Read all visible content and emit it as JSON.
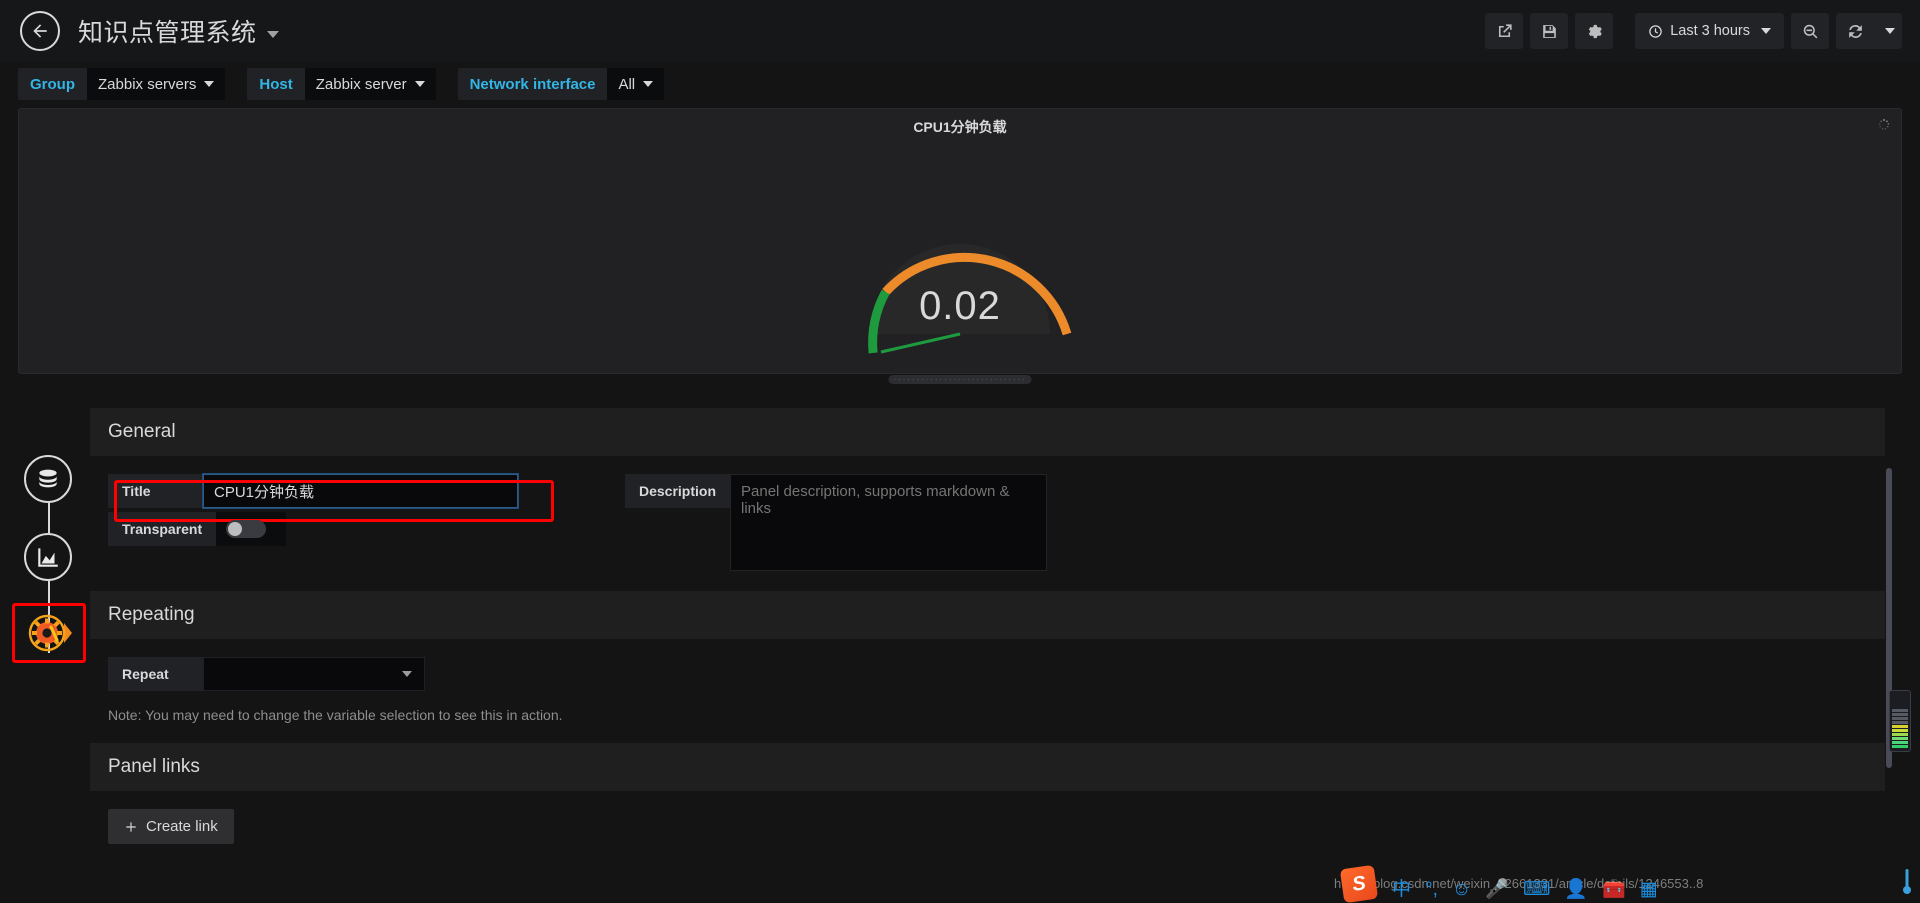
{
  "topnav": {
    "back_icon": "back-arrow-icon",
    "dashboard_title": "知识点管理系统",
    "share_icon": "share-icon",
    "save_icon": "save-icon",
    "settings_icon": "gear-icon",
    "time_range": "Last 3 hours",
    "time_clock_icon": "clock-icon",
    "zoom_out_icon": "zoom-out-icon",
    "refresh_icon": "refresh-icon",
    "refresh_caret_icon": "chevron-down-icon"
  },
  "variables": [
    {
      "label": "Group",
      "value": "Zabbix servers"
    },
    {
      "label": "Host",
      "value": "Zabbix server"
    },
    {
      "label": "Network interface",
      "value": "All"
    }
  ],
  "panel": {
    "title": "CPU1分钟负载",
    "spinner_icon": "loading-spinner-icon",
    "resize_handle": "resize-handle"
  },
  "chart_data": {
    "type": "gauge",
    "title": "CPU1分钟负载",
    "value": 0.02,
    "value_label": "0.02",
    "min": 0,
    "max": 100,
    "unit": "",
    "thresholds": [
      {
        "from": 0,
        "to": 10,
        "color": "#299c46"
      },
      {
        "from": 10,
        "to": 100,
        "color": "#ed8b2b"
      }
    ],
    "arc_start_angle": -130,
    "arc_end_angle": 130,
    "needle_color": "#299c46",
    "needle_angle": -130,
    "show_threshold_markers": true,
    "show_threshold_labels": false
  },
  "edit_rail": {
    "items": [
      {
        "name": "queries",
        "icon": "database-icon"
      },
      {
        "name": "visualization",
        "icon": "area-chart-icon"
      },
      {
        "name": "general",
        "icon": "gear-wrench-icon"
      }
    ]
  },
  "options": {
    "general": {
      "header": "General",
      "title_label": "Title",
      "title_value": "CPU1分钟负载",
      "transparent_label": "Transparent",
      "transparent_on": false,
      "description_label": "Description",
      "description_value": "",
      "description_placeholder": "Panel description, supports markdown & links"
    },
    "repeating": {
      "header": "Repeating",
      "repeat_label": "Repeat",
      "repeat_value": "",
      "repeat_placeholder": "",
      "note": "Note: You may need to change the variable selection to see this in action."
    },
    "panel_links": {
      "header": "Panel links",
      "create_link_label": "Create link",
      "create_link_icon": "plus-icon"
    }
  },
  "highlights": {
    "title_field_color": "#ff0000",
    "rail_general_color": "#ff0000"
  },
  "ime": {
    "url_text": "https://blog.csdn.net/weixin_42661331/article/details/1246553..8",
    "logo": "sogou-logo",
    "icons": [
      "chinese-mode-icon",
      "punctuation-icon",
      "emoji-icon",
      "voice-input-icon",
      "soft-keyboard-icon",
      "user-icon",
      "toolbox-icon",
      "apps-icon"
    ]
  }
}
